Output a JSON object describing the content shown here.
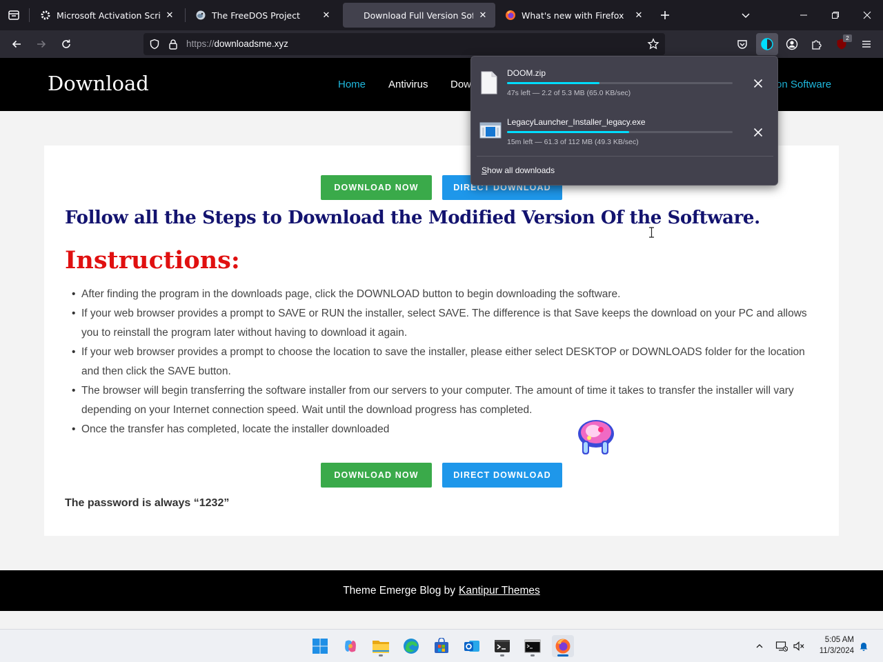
{
  "browser": {
    "tabs": [
      {
        "title": "Microsoft Activation Scripts (MAS)",
        "favicon": "gear-icon",
        "active": false
      },
      {
        "title": "The FreeDOS Project",
        "favicon": "freedos-fish-icon",
        "active": false
      },
      {
        "title": "Download Full Version Software",
        "favicon": "none",
        "active": true
      },
      {
        "title": "What's new with Firefox",
        "favicon": "firefox-icon",
        "active": false
      }
    ],
    "url_protocol": "https://",
    "url_domain": "downloadsme.xyz",
    "extension_badge": "2"
  },
  "site": {
    "title": "Download",
    "nav": [
      "Home",
      "Antivirus",
      "Dow",
      "on Software"
    ],
    "buttons": {
      "download_now": "DOWNLOAD NOW",
      "direct_download": "DIRECT DOWNLOAD"
    },
    "main_heading": "Follow all the Steps to Download the Modified Version Of the Software.",
    "instructions_heading": "Instructions:",
    "instructions": [
      "After finding the program in the downloads page, click the DOWNLOAD button to begin downloading the software.",
      "If your web browser provides a prompt to SAVE or RUN the installer, select SAVE. The difference is that Save keeps the download on your PC and allows you to reinstall the program later without having to download it again.",
      "If your web browser provides a prompt to choose the location to save the installer, please either select DESKTOP or DOWNLOADS folder for the location and then click the SAVE button.",
      "The browser will begin transferring the software installer from our servers to your computer. The amount of time it takes to transfer the installer will vary depending on your Internet connection speed. Wait until the download progress has completed.",
      "Once the transfer has completed, locate the installer downloaded"
    ],
    "password_note": "The password is always “1232”",
    "footer_text": "Theme Emerge Blog by",
    "footer_link": "Kantipur Themes"
  },
  "downloads_panel": {
    "items": [
      {
        "name": "DOOM.zip",
        "status": "47s left — 2.2 of 5.3 MB (65.0 KB/sec)",
        "progress": 0.41
      },
      {
        "name": "LegacyLauncher_Installer_legacy.exe",
        "status": "15m left — 61.3 of 112 MB (49.3 KB/sec)",
        "progress": 0.54
      }
    ],
    "show_all_prefix": "S",
    "show_all_rest": "how all downloads"
  },
  "taskbar": {
    "apps": [
      "windows-start-icon",
      "copilot-icon",
      "file-explorer-icon",
      "edge-icon",
      "microsoft-store-icon",
      "outlook-icon",
      "terminal-icon",
      "command-prompt-icon",
      "firefox-icon"
    ],
    "time": "5:05 AM",
    "date": "11/3/2024"
  },
  "colors": {
    "accent_cyan": "#00ddff",
    "heading_navy": "#13136f",
    "instructions_red": "#e01010",
    "button_green": "#3aaa4a",
    "button_blue": "#1e97ea"
  }
}
